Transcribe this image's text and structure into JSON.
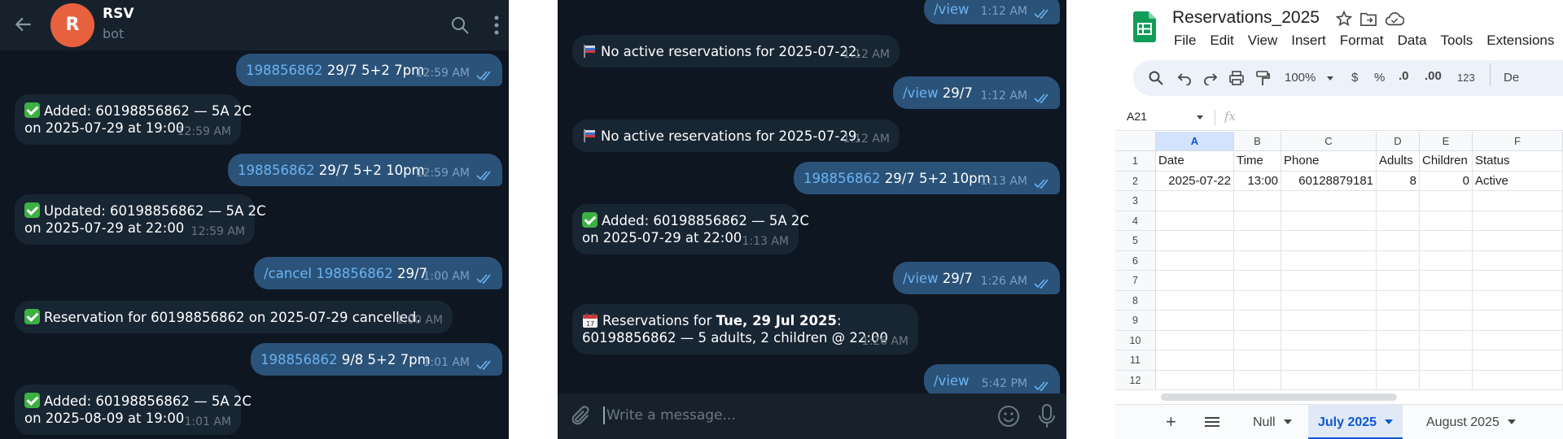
{
  "chat1": {
    "bot_name": "RSV",
    "bot_status": "bot",
    "avatar_letter": "R",
    "messages": [
      {
        "cmd": "198856862",
        "text": " 29/7 5+2 7pm",
        "time": "12:59 AM"
      },
      {
        "line1": "Added: 60198856862 — 5A 2C",
        "line2": "on 2025-07-29 at 19:00",
        "time": "12:59 AM"
      },
      {
        "cmd": "198856862",
        "text": " 29/7 5+2 10pm",
        "time": "12:59 AM"
      },
      {
        "line1": "Updated: 60198856862 — 5A 2C",
        "line2": "on 2025-07-29 at 22:00",
        "time": "12:59 AM"
      },
      {
        "cmd": "/cancel 198856862",
        "text": " 29/7",
        "time": "1:00 AM"
      },
      {
        "line1": "Reservation for 60198856862 on 2025-07-29 cancelled.",
        "time": "1:00 AM"
      },
      {
        "cmd": "198856862",
        "text": " 9/8 5+2 7pm",
        "time": "1:01 AM"
      },
      {
        "line1": "Added: 60198856862 — 5A 2C",
        "line2": "on 2025-08-09 at 19:00",
        "time": "1:01 AM"
      }
    ]
  },
  "chat2": {
    "input_placeholder": "Write a message...",
    "messages": [
      {
        "cmd": "/view",
        "time": "1:12 AM"
      },
      {
        "line1": "No active reservations for 2025-07-22.",
        "time": "1:12 AM"
      },
      {
        "cmd": "/view",
        "text": " 29/7",
        "time": "1:12 AM"
      },
      {
        "line1": "No active reservations for 2025-07-29.",
        "time": "1:12 AM"
      },
      {
        "cmd": "198856862",
        "text": " 29/7 5+2 10pm",
        "time": "1:13 AM"
      },
      {
        "line1": "Added: 60198856862 — 5A 2C",
        "line2": "on 2025-07-29 at 22:00",
        "time": "1:13 AM"
      },
      {
        "cmd": "/view",
        "text": " 29/7",
        "time": "1:26 AM"
      },
      {
        "line1_pre": "Reservations for ",
        "line1_bold": "Tue, 29 Jul 2025",
        "line1_post": ":",
        "line2": "60198856862 — 5 adults, 2 children @ 22:00",
        "time": "1:26 AM"
      },
      {
        "cmd": "/view",
        "time": "5:42 PM"
      }
    ]
  },
  "sheets": {
    "title": "Reservations_2025",
    "menu": [
      "File",
      "Edit",
      "View",
      "Insert",
      "Format",
      "Data",
      "Tools",
      "Extensions"
    ],
    "toolbar": {
      "zoom": "100%",
      "currency": "$",
      "percent": "%",
      "dec_less": ".0",
      "dec_more": ".00",
      "number_format": "123",
      "default_font": "De"
    },
    "name_box": "A21",
    "fx_label": "fx",
    "columns": [
      "A",
      "B",
      "C",
      "D",
      "E",
      "F"
    ],
    "rows": [
      "1",
      "2",
      "3",
      "4",
      "5",
      "6",
      "7",
      "8",
      "9",
      "10",
      "11",
      "12"
    ],
    "header_row": [
      "Date",
      "Time",
      "Phone",
      "Adults",
      "Children",
      "Status"
    ],
    "data_row": [
      "2025-07-22",
      "13:00",
      "60128879181",
      "8",
      "0",
      "Active"
    ],
    "tabs": [
      "Null",
      "July 2025",
      "August 2025"
    ],
    "active_tab": "July 2025",
    "accent_color": "#0b57d0"
  }
}
